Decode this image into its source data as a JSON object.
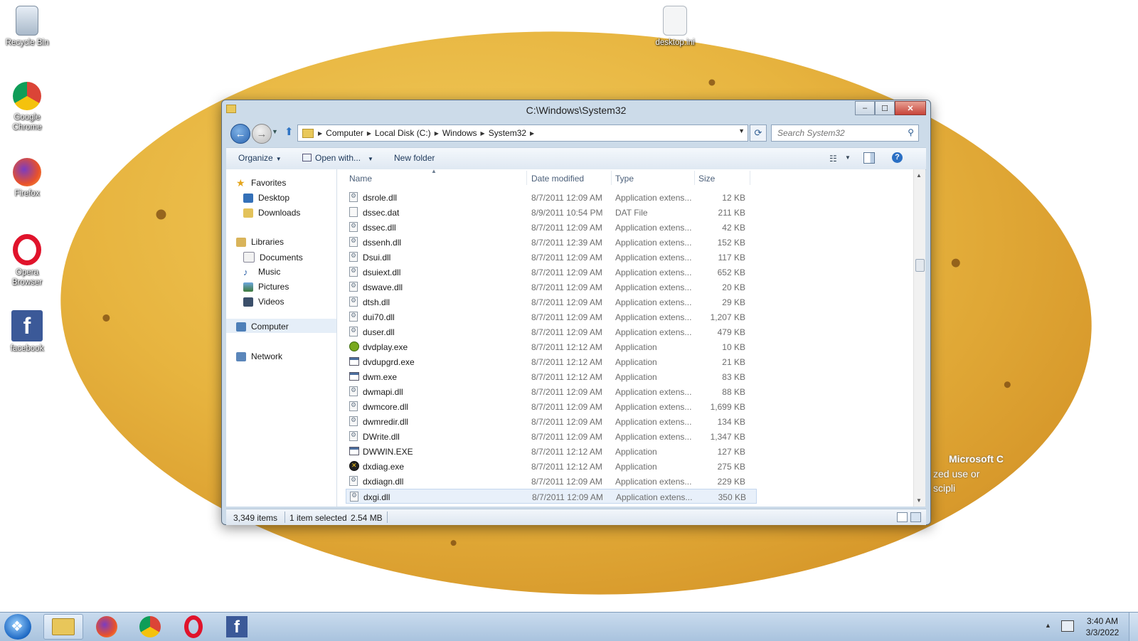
{
  "desktop": {
    "icons": [
      {
        "label": "Recycle Bin"
      },
      {
        "label": "Google Chrome"
      },
      {
        "label": "Firefox"
      },
      {
        "label": "Opera Browser"
      },
      {
        "label": "facebook"
      },
      {
        "label": "desktop.ini"
      }
    ],
    "watermark_line1": "Microsoft C",
    "watermark_line2": "zed use or",
    "watermark_line3": "scipli"
  },
  "window": {
    "title": "C:\\Windows\\System32",
    "minimize": "–",
    "maximize": "☐",
    "close": "✕"
  },
  "address": {
    "crumbs": [
      "Computer",
      "Local Disk (C:)",
      "Windows",
      "System32"
    ]
  },
  "search": {
    "placeholder": "Search System32"
  },
  "toolbar": {
    "organize": "Organize",
    "open_with": "Open with...",
    "new_folder": "New folder"
  },
  "navpane": {
    "favorites": "Favorites",
    "desktop": "Desktop",
    "downloads": "Downloads",
    "libraries": "Libraries",
    "documents": "Documents",
    "music": "Music",
    "pictures": "Pictures",
    "videos": "Videos",
    "computer": "Computer",
    "network": "Network"
  },
  "columns": {
    "name": "Name",
    "date": "Date modified",
    "type": "Type",
    "size": "Size"
  },
  "files": [
    {
      "name": "dsrole.dll",
      "date": "8/7/2011 12:09 AM",
      "type": "Application extens...",
      "size": "12 KB",
      "icon": "dll"
    },
    {
      "name": "dssec.dat",
      "date": "8/9/2011 10:54 PM",
      "type": "DAT File",
      "size": "211 KB",
      "icon": "file"
    },
    {
      "name": "dssec.dll",
      "date": "8/7/2011 12:09 AM",
      "type": "Application extens...",
      "size": "42 KB",
      "icon": "dll"
    },
    {
      "name": "dssenh.dll",
      "date": "8/7/2011 12:39 AM",
      "type": "Application extens...",
      "size": "152 KB",
      "icon": "dll"
    },
    {
      "name": "Dsui.dll",
      "date": "8/7/2011 12:09 AM",
      "type": "Application extens...",
      "size": "117 KB",
      "icon": "dll"
    },
    {
      "name": "dsuiext.dll",
      "date": "8/7/2011 12:09 AM",
      "type": "Application extens...",
      "size": "652 KB",
      "icon": "dll"
    },
    {
      "name": "dswave.dll",
      "date": "8/7/2011 12:09 AM",
      "type": "Application extens...",
      "size": "20 KB",
      "icon": "dll"
    },
    {
      "name": "dtsh.dll",
      "date": "8/7/2011 12:09 AM",
      "type": "Application extens...",
      "size": "29 KB",
      "icon": "dll"
    },
    {
      "name": "dui70.dll",
      "date": "8/7/2011 12:09 AM",
      "type": "Application extens...",
      "size": "1,207 KB",
      "icon": "dll"
    },
    {
      "name": "duser.dll",
      "date": "8/7/2011 12:09 AM",
      "type": "Application extens...",
      "size": "479 KB",
      "icon": "dll"
    },
    {
      "name": "dvdplay.exe",
      "date": "8/7/2011 12:12 AM",
      "type": "Application",
      "size": "10 KB",
      "icon": "dvd"
    },
    {
      "name": "dvdupgrd.exe",
      "date": "8/7/2011 12:12 AM",
      "type": "Application",
      "size": "21 KB",
      "icon": "exe"
    },
    {
      "name": "dwm.exe",
      "date": "8/7/2011 12:12 AM",
      "type": "Application",
      "size": "83 KB",
      "icon": "exe"
    },
    {
      "name": "dwmapi.dll",
      "date": "8/7/2011 12:09 AM",
      "type": "Application extens...",
      "size": "88 KB",
      "icon": "dll"
    },
    {
      "name": "dwmcore.dll",
      "date": "8/7/2011 12:09 AM",
      "type": "Application extens...",
      "size": "1,699 KB",
      "icon": "dll"
    },
    {
      "name": "dwmredir.dll",
      "date": "8/7/2011 12:09 AM",
      "type": "Application extens...",
      "size": "134 KB",
      "icon": "dll"
    },
    {
      "name": "DWrite.dll",
      "date": "8/7/2011 12:09 AM",
      "type": "Application extens...",
      "size": "1,347 KB",
      "icon": "dll"
    },
    {
      "name": "DWWIN.EXE",
      "date": "8/7/2011 12:12 AM",
      "type": "Application",
      "size": "127 KB",
      "icon": "exe"
    },
    {
      "name": "dxdiag.exe",
      "date": "8/7/2011 12:12 AM",
      "type": "Application",
      "size": "275 KB",
      "icon": "dx"
    },
    {
      "name": "dxdiagn.dll",
      "date": "8/7/2011 12:09 AM",
      "type": "Application extens...",
      "size": "229 KB",
      "icon": "dll"
    },
    {
      "name": "dxgi.dll",
      "date": "8/7/2011 12:09 AM",
      "type": "Application extens...",
      "size": "350 KB",
      "icon": "dll"
    }
  ],
  "status": {
    "items": "3,349 items",
    "selected": "1 item selected",
    "size": "2.54 MB"
  },
  "taskbar": {
    "apps": [
      "file-explorer",
      "firefox",
      "google-chrome",
      "opera",
      "facebook"
    ],
    "time": "3:40 AM",
    "date": "3/3/2022"
  },
  "colors": {
    "accent": "#2a64b0",
    "selection": "#e8f0fa"
  }
}
